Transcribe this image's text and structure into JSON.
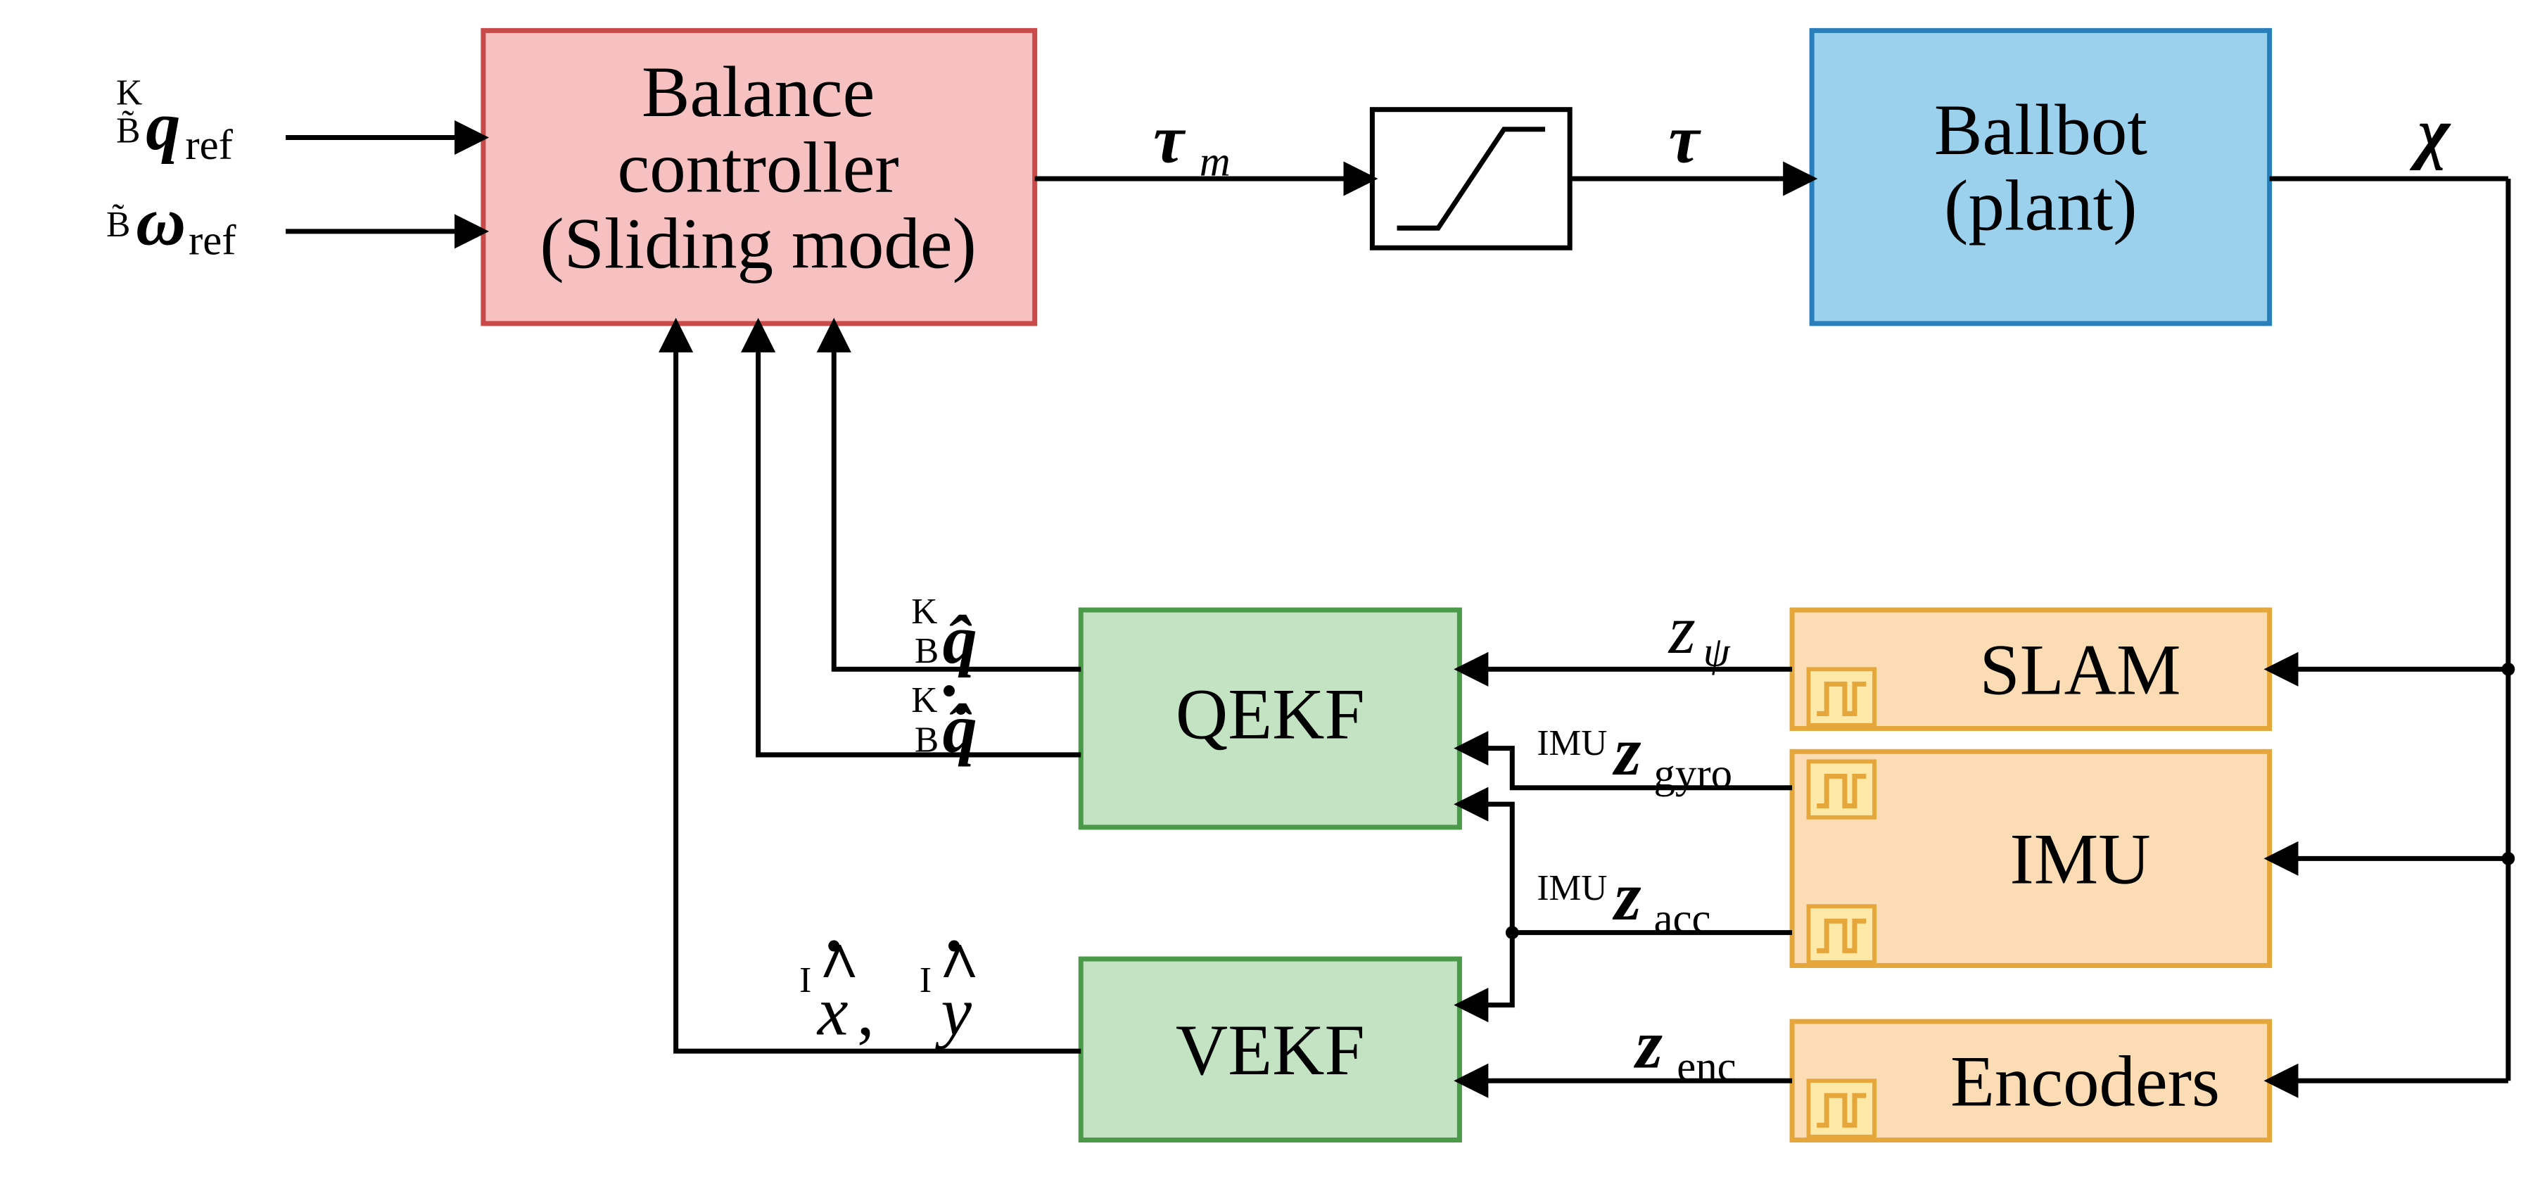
{
  "blocks": {
    "balance": {
      "line1": "Balance",
      "line2": "controller",
      "line3": "(Sliding mode)"
    },
    "ballbot": {
      "line1": "Ballbot",
      "line2": "(plant)"
    },
    "qekf": "QEKF",
    "vekf": "VEKF",
    "slam": "SLAM",
    "imu": "IMU",
    "encoders": "Encoders"
  },
  "signals": {
    "qref": {
      "preTop": "K",
      "preBot": "B̃",
      "body": "q",
      "sub": "ref"
    },
    "omegaref": {
      "pre": "B̃",
      "body": "ω",
      "sub": "ref"
    },
    "tau_m": {
      "body": "τ",
      "sub": "m"
    },
    "tau": {
      "body": "τ"
    },
    "chi": {
      "body": "χ"
    },
    "qhat": {
      "preTop": "K",
      "preBot": "B",
      "body": "q̂"
    },
    "qdothat": {
      "preTop": "K",
      "preBot": "B",
      "body": "q̂̇"
    },
    "xdothat_ydothat": "x̂̇,   ŷ̇",
    "xdot_pre": "I",
    "ydot_pre": "I",
    "z_psi": {
      "body": "z",
      "sub": "ψ"
    },
    "z_gyro": {
      "pre": "IMU",
      "body": "z",
      "sub": "gyro"
    },
    "z_acc": {
      "pre": "IMU",
      "body": "z",
      "sub": "acc"
    },
    "z_enc": {
      "body": "z",
      "sub": "enc"
    },
    "hat": "^",
    "dot": "·",
    "tilde": "~",
    "comma": ","
  }
}
